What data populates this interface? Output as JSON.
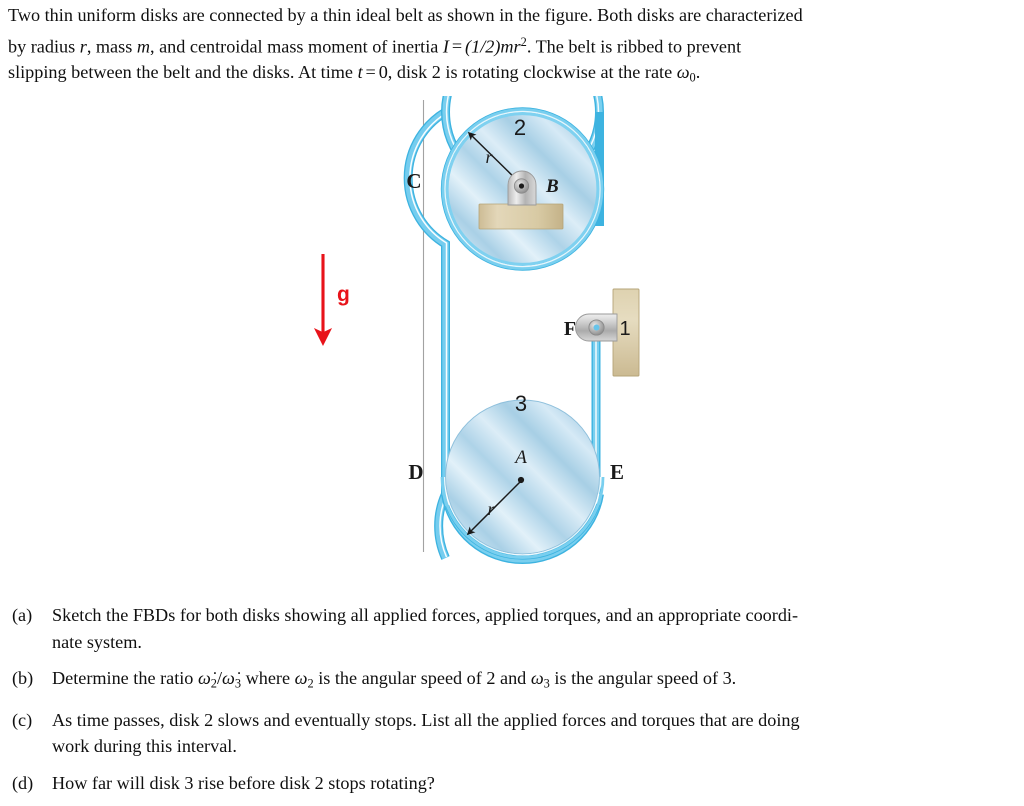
{
  "problem": {
    "line1": "Two thin uniform disks are connected by a thin ideal belt as shown in the figure.  Both disks are characterized",
    "line2_a": "by radius",
    "line2_r": "r",
    "line2_b": ", mass",
    "line2_m": "m",
    "line2_c": ", and centroidal mass moment of inertia",
    "line2_I": "I",
    "line2_eq": "=",
    "line2_expr": "(1/2)mr",
    "line2_exp": "2",
    "line2_d": ".  The belt is ribbed to prevent",
    "line3_a": "slipping between the belt and the disks.  At time",
    "line3_t": "t",
    "line3_eq": "=",
    "line3_zero": "0",
    "line3_b": ", disk 2 is rotating clockwise at the rate",
    "line3_omega": "ω",
    "line3_omega_sub": "0",
    "line3_c": "."
  },
  "figure": {
    "disk2_label": "2",
    "disk3_label": "3",
    "pulley1_label": "1",
    "center_b_label": "B",
    "center_a_label": "A",
    "point_c_label": "C",
    "point_d_label": "D",
    "point_e_label": "E",
    "point_f_label": "F",
    "radius_label_top": "r",
    "radius_label_bottom": "r",
    "gravity_label": "g",
    "colors": {
      "gravity_arrow": "#e8131a",
      "belt": "#5bc6ec",
      "belt_highlight": "#ffffff",
      "belt_edge": "#29a8d8",
      "disk_light": "#e8f4fb",
      "disk_mid": "#b9d9ec",
      "disk_dark": "#8fc2de",
      "bracket_tan": "#d9cba8",
      "bracket_tan_edge": "#b9a97f",
      "pulley_gray": "#c9c9c9",
      "pulley_gray_dark": "#8f8f8f",
      "reference_line": "#9b9b9b",
      "label_text": "#1a1a1a"
    }
  },
  "questions": [
    {
      "label": "(a)",
      "line1": "Sketch the FBDs for both disks showing all applied forces, applied torques, and an appropriate coordi-",
      "line2": "nate system."
    },
    {
      "label": "(b)",
      "line1_a": "Determine the ratio",
      "ratio_num": "ω̇",
      "ratio_num_sub": "2",
      "ratio_slash": "/",
      "ratio_den": "ω̇",
      "ratio_den_sub": "3",
      "line1_b": "where",
      "w2": "ω",
      "w2_sub": "2",
      "line1_c": "is the angular speed of 2 and",
      "w3": "ω",
      "w3_sub": "3",
      "line1_d": "is the angular speed of 3."
    },
    {
      "label": "(c)",
      "line1": "As time passes, disk 2 slows and eventually stops.  List all the applied forces and torques that are doing",
      "line2": "work during this interval."
    },
    {
      "label": "(d)",
      "line1": "How far will disk 3 rise before disk 2 stops rotating?"
    }
  ]
}
